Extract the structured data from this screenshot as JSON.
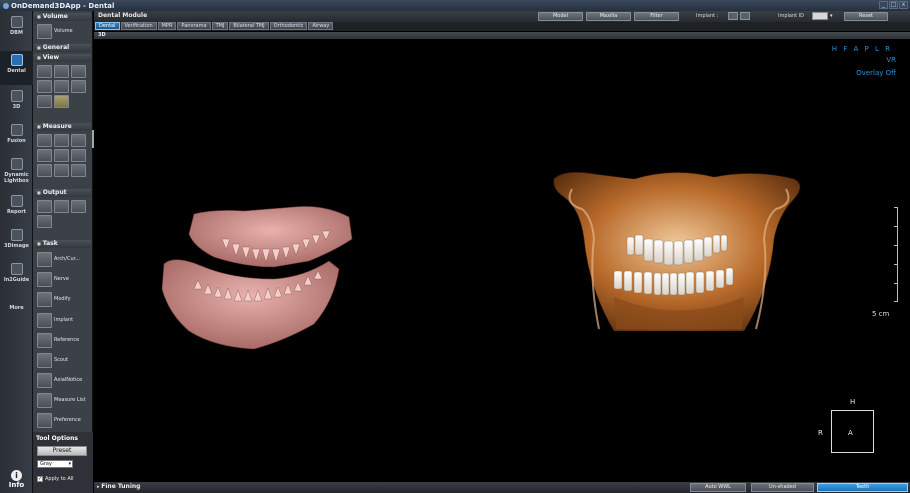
{
  "window": {
    "title": "OnDemand3DApp - Dental",
    "controls": [
      "_",
      "□",
      "x"
    ]
  },
  "nav": [
    {
      "label": "DBM",
      "icon": "database-icon"
    },
    {
      "label": "Dental",
      "icon": "tooth-icon",
      "active": true
    },
    {
      "label": "3D",
      "icon": "3d-icon"
    },
    {
      "label": "Fusion",
      "icon": "fusion-icon"
    },
    {
      "label": "Dynamic Lightbox",
      "icon": "lightbox-icon"
    },
    {
      "label": "Report",
      "icon": "report-icon"
    },
    {
      "label": "3Dimage",
      "icon": "image-icon"
    },
    {
      "label": "In2Guide",
      "icon": "guide-icon"
    },
    {
      "label": "More",
      "icon": "more-icon"
    }
  ],
  "info_label": "Info",
  "panel": {
    "volume_header": "Volume",
    "volume_label": "Volume",
    "general_header": "General",
    "view_header": "View",
    "measure_header": "Measure",
    "output_header": "Output",
    "task_header": "Task",
    "tasks": [
      "Arch/Cur...",
      "Nerve",
      "Modify",
      "Implant",
      "Reference",
      "Scout",
      "AxialNotice",
      "Measure List",
      "Preference"
    ],
    "tool_options_header": "Tool Options",
    "preset_label": "Preset",
    "gray_label": "Gray",
    "apply_all_label": "Apply to All"
  },
  "toolbar": {
    "module_title": "Dental Module",
    "buttons": [
      "Model",
      "Maxilla",
      "Filter"
    ],
    "implant_label": "Implant :",
    "implant_id_label": "Implant ID",
    "reset_label": "Reset"
  },
  "tabs": [
    "Dental",
    "Verification",
    "MPR",
    "Panorama",
    "TMJ",
    "Bilateral TMJ",
    "Orthodontic",
    "Airway"
  ],
  "view": {
    "header": "3D",
    "orientation": "H F A P L R",
    "mode": "VR",
    "overlay": "Overlay Off",
    "scale_label": "5 cm",
    "cube_front": "A",
    "cube_top": "H",
    "cube_side": "R"
  },
  "bottom": {
    "fine_tuning": "Fine Tuning",
    "auto_wwl": "Auto WWL",
    "unshaded": "Un-shaded",
    "teeth": "Teeth"
  },
  "colors": {
    "accent": "#2f8fd8",
    "active_tab": "#2f7fc0",
    "model_pink": "#d79a96",
    "bone_orange": "#b86a2a"
  }
}
